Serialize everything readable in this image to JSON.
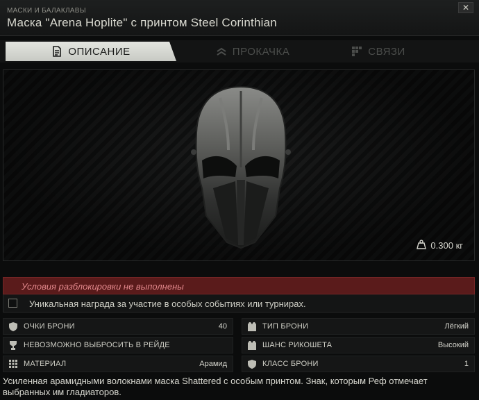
{
  "header": {
    "category": "МАСКИ И БАЛАКЛАВЫ",
    "title": "Маска \"Arena Hoplite\" с принтом Steel Corinthian",
    "close_label": "✕"
  },
  "tabs": [
    {
      "label": "ОПИСАНИЕ",
      "icon": "document-icon",
      "active": true
    },
    {
      "label": "ПРОКАЧКА",
      "icon": "chevrons-up-icon",
      "active": false
    },
    {
      "label": "СВЯЗИ",
      "icon": "grid-icon",
      "active": false
    }
  ],
  "preview": {
    "weight": "0.300 кг",
    "weight_icon": "weight-icon"
  },
  "unlock": {
    "status": "Условия разблокировки не выполнены",
    "requirement": "Уникальная награда за участие в особых событиях или турнирах.",
    "requirement_checked": false
  },
  "stats": [
    {
      "label": "ОЧКИ БРОНИ",
      "value": "40",
      "icon": "shield-icon"
    },
    {
      "label": "ТИП БРОНИ",
      "value": "Лёгкий",
      "icon": "vest-icon"
    },
    {
      "label": "НЕВОЗМОЖНО ВЫБРОСИТЬ В РЕЙДЕ",
      "value": "",
      "icon": "goblet-icon"
    },
    {
      "label": "ШАНС РИКОШЕТА",
      "value": "Высокий",
      "icon": "vest-icon"
    },
    {
      "label": "МАТЕРИАЛ",
      "value": "Арамид",
      "icon": "grid-icon"
    },
    {
      "label": "КЛАСС БРОНИ",
      "value": "1",
      "icon": "shield-icon"
    }
  ],
  "description": "Усиленная арамидными волокнами маска Shattered с особым принтом. Знак, которым Реф отмечает выбранных им гладиаторов.",
  "colors": {
    "unlock_bg": "#5a1b1b",
    "unlock_text": "#e0868a",
    "active_tab_bg": "#d8d9d4"
  }
}
